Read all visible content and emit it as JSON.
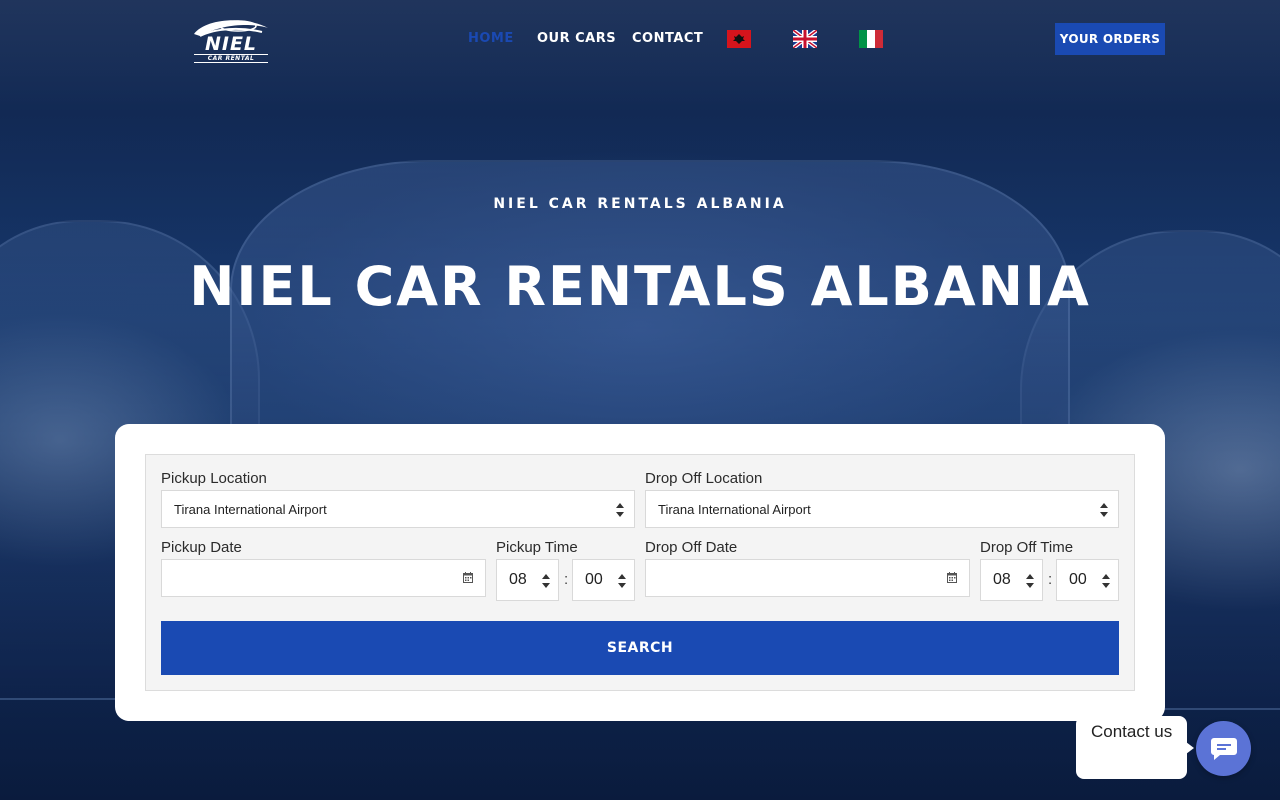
{
  "brand": {
    "name": "NIEL",
    "tagline": "CAR RENTAL"
  },
  "nav": {
    "items": [
      {
        "label": "HOME",
        "active": true
      },
      {
        "label": "OUR CARS",
        "active": false
      },
      {
        "label": "CONTACT",
        "active": false
      }
    ],
    "languages": [
      "albanian-flag-icon",
      "uk-flag-icon",
      "italian-flag-icon"
    ],
    "orders_label": "YOUR ORDERS"
  },
  "hero": {
    "subtitle": "NIEL CAR RENTALS ALBANIA",
    "title": "NIEL CAR RENTALS ALBANIA"
  },
  "booking": {
    "pickup_location": {
      "label": "Pickup Location",
      "value": "Tirana International Airport"
    },
    "dropoff_location": {
      "label": "Drop Off Location",
      "value": "Tirana International Airport"
    },
    "pickup_date": {
      "label": "Pickup Date",
      "value": ""
    },
    "pickup_time": {
      "label": "Pickup Time",
      "hour": "08",
      "minute": "00"
    },
    "dropoff_date": {
      "label": "Drop Off Date",
      "value": ""
    },
    "dropoff_time": {
      "label": "Drop Off Time",
      "hour": "08",
      "minute": "00"
    },
    "time_separator": ":",
    "search_label": "SEARCH"
  },
  "contact_widget": {
    "label": "Contact us"
  },
  "colors": {
    "accent": "#1a4ab3",
    "active_nav": "#1a49b2",
    "chat": "#5b73d6"
  }
}
